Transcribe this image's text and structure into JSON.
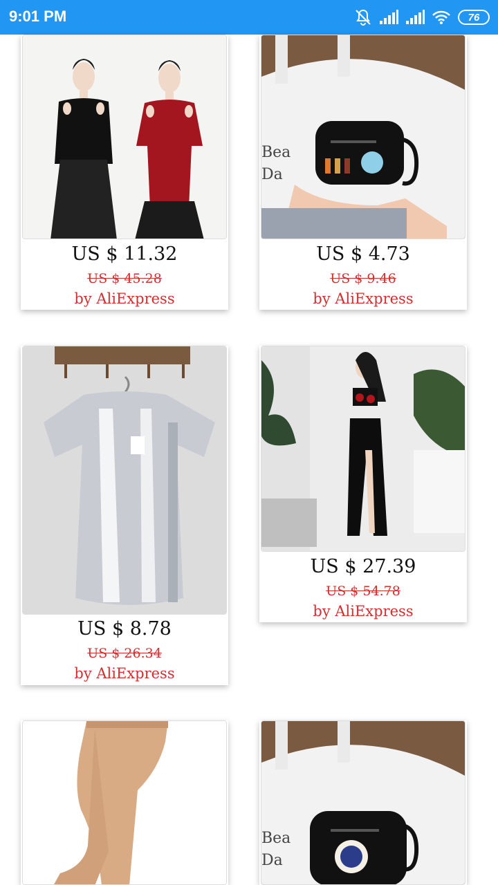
{
  "status_bar": {
    "time": "9:01 PM",
    "battery": "76",
    "icons": [
      "mute-icon",
      "signal-icon",
      "signal-icon",
      "wifi-icon",
      "battery-icon"
    ]
  },
  "products": [
    {
      "price": "US $ 11.32",
      "original_price": "US $ 45.28",
      "seller": "by AliExpress",
      "image": "two women in cut-out shoulder tops"
    },
    {
      "price": "US $ 4.73",
      "original_price": "US $ 9.46",
      "seller": "by AliExpress",
      "image": "black earbuds case with characters"
    },
    {
      "price": "US $ 8.78",
      "original_price": "US $ 26.34",
      "seller": "by AliExpress",
      "image": "silver metallic t-shirt on hanger"
    },
    {
      "price": "US $ 27.39",
      "original_price": "US $ 54.78",
      "seller": "by AliExpress",
      "image": "woman in black dance costume"
    },
    {
      "price": "",
      "original_price": "",
      "seller": "",
      "image": "tan ballet tights"
    },
    {
      "price": "",
      "original_price": "",
      "seller": "",
      "image": "black earbuds case with badge"
    }
  ]
}
